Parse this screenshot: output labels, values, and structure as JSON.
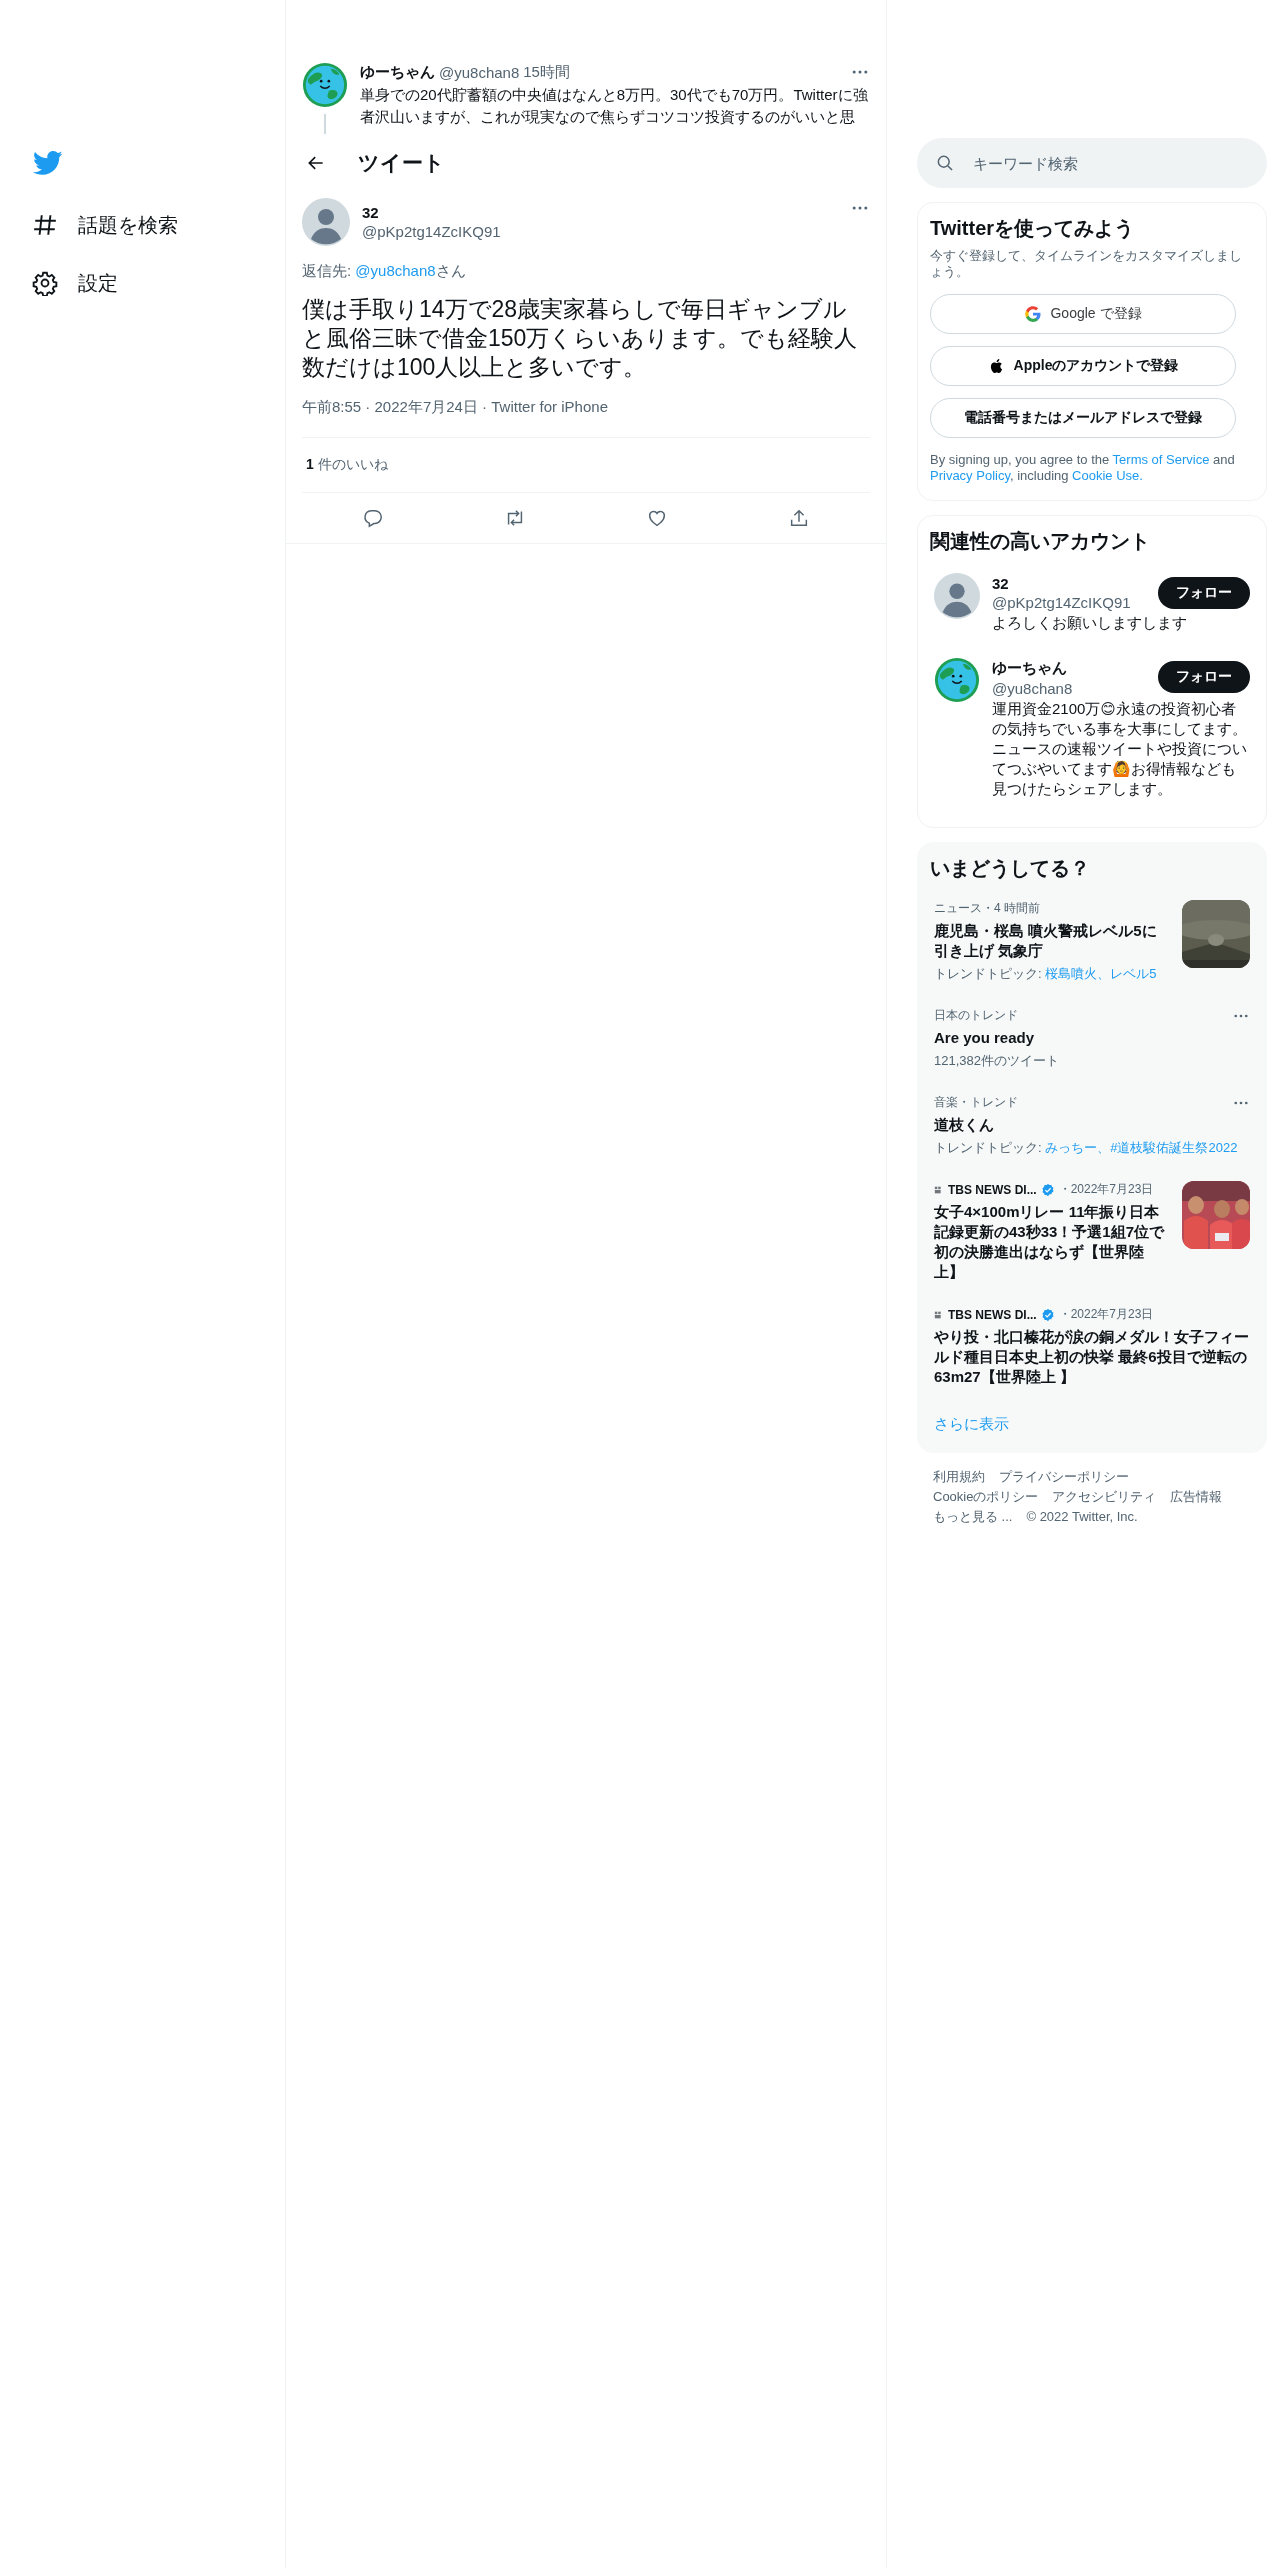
{
  "sidebar": {
    "items": [
      {
        "kind": "explore",
        "label": "話題を検索"
      },
      {
        "kind": "settings",
        "label": "設定"
      }
    ]
  },
  "parent_tweet": {
    "avatar": {
      "kind": "earth"
    },
    "name": "ゆーちゃん",
    "handle": "@yu8chan8",
    "time": "15時間",
    "text": "単身での20代貯蓄額の中央値はなんと8万円。30代でも70万円。Twitterに強者沢山いますが、これが現実なので焦らずコツコツ投資するのがいいと思"
  },
  "header": {
    "title": "ツイート"
  },
  "tweet": {
    "avatar": {
      "kind": "default"
    },
    "name": "32",
    "handle": "@pKp2tg14ZcIKQ91",
    "reply_label": "返信先: ",
    "reply_to": "@yu8chan8",
    "reply_suffix": "さん",
    "text": "僕は手取り14万で28歳実家暮らしで毎日ギャンブルと風俗三昧で借金150万くらいあります。でも経験人数だけは100人以上と多いです。",
    "meta": "午前8:55 · 2022年7月24日 · Twitter for iPhone",
    "likes_count": "1",
    "likes_label": "件のいいね"
  },
  "search": {
    "placeholder": "キーワード検索"
  },
  "signup": {
    "title": "Twitterを使ってみよう",
    "subtitle": "今すぐ登録して、タイムラインをカスタマイズしましょう。",
    "buttons": [
      {
        "kind": "google",
        "label": "Google で登録"
      },
      {
        "kind": "apple",
        "label": "Appleのアカウントで登録"
      },
      {
        "kind": "plain",
        "label": "電話番号またはメールアドレスで登録"
      }
    ],
    "legal": [
      {
        "text": "By signing up, you agree to the ",
        "link": false
      },
      {
        "text": "Terms of Service",
        "link": true
      },
      {
        "text": " and ",
        "link": false
      },
      {
        "text": "Privacy Policy",
        "link": true
      },
      {
        "text": ", including ",
        "link": false
      },
      {
        "text": "Cookie Use.",
        "link": true
      }
    ]
  },
  "suggestions": {
    "title": "関連性の高いアカウント",
    "accounts": [
      {
        "avatar": {
          "kind": "default"
        },
        "name": "32",
        "handle": "@pKp2tg14ZcIKQ91",
        "bio": "よろしくお願いしますします",
        "button": "フォロー"
      },
      {
        "avatar": {
          "kind": "earth"
        },
        "name": "ゆーちゃん",
        "handle": "@yu8chan8",
        "bio": "運用資金2100万😊永遠の投資初心者の気持ちでいる事を大事にしてます。ニュースの速報ツイートや投資についてつぶやいてます🙆お得情報なども見つけたらシェアします。",
        "button": "フォロー"
      }
    ]
  },
  "trends": {
    "title": "いまどうしてる？",
    "items": [
      {
        "kind": "news",
        "meta": "ニュース・4 時間前",
        "title": "鹿児島・桜島 噴火警戒レベル5に引き上げ 気象庁",
        "topics_label": "トレンドトピック: ",
        "topics": "桜島噴火、レベル5",
        "has_picture": true
      },
      {
        "kind": "trend",
        "meta": "日本のトレンド",
        "title": "Are you ready",
        "count": "121,382件のツイート"
      },
      {
        "kind": "trend",
        "meta": "音楽・トレンド",
        "title": "道枝くん",
        "topics_label": "トレンドトピック: ",
        "topics": "みっちー、#道枝駿佑誕生祭2022"
      },
      {
        "kind": "source",
        "source": "TBS NEWS DI...",
        "verified": true,
        "date": "・2022年7月23日",
        "title": "女子4×100mリレー 11年振り日本記録更新の43秒33！予選1組7位で初の決勝進出はならず【世界陸上】",
        "has_picture": true
      },
      {
        "kind": "source",
        "source": "TBS NEWS DI...",
        "verified": true,
        "date": "・2022年7月23日",
        "title": "やり投・北口榛花が涙の銅メダル！女子フィールド種目日本史上初の快挙 最終6投目で逆転の63m27【世界陸上 】",
        "has_picture": false
      }
    ],
    "more": "さらに表示"
  },
  "footer": {
    "rows": [
      [
        "利用規約",
        "プライバシーポリシー"
      ],
      [
        "Cookieのポリシー",
        "アクセシビリティ",
        "広告情報"
      ],
      [
        "もっと見る ..."
      ]
    ],
    "copyright": "© 2022 Twitter, Inc."
  }
}
